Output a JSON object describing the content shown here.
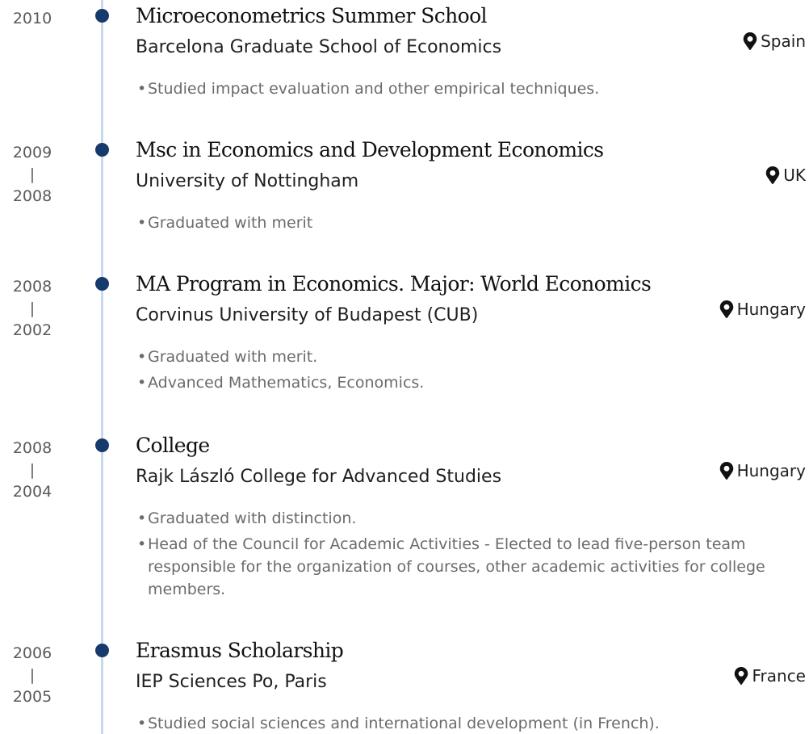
{
  "entries": [
    {
      "years": [
        "2010"
      ],
      "title": "Microeconometrics Summer School",
      "institution": "Barcelona Graduate School of Economics",
      "location": "Spain",
      "bullets": [
        "Studied impact evaluation and other empirical techniques."
      ]
    },
    {
      "years": [
        "2009",
        "2008"
      ],
      "title": "Msc in Economics and Development Economics",
      "institution": "University of Nottingham",
      "location": "UK",
      "bullets": [
        "Graduated with merit"
      ]
    },
    {
      "years": [
        "2008",
        "2002"
      ],
      "title": "MA Program in Economics. Major: World Economics",
      "institution": "Corvinus University of Budapest (CUB)",
      "location": "Hungary",
      "bullets": [
        "Graduated with merit.",
        "Advanced Mathematics, Economics."
      ]
    },
    {
      "years": [
        "2008",
        "2004"
      ],
      "title": "College",
      "institution": "Rajk László College for Advanced Studies",
      "location": "Hungary",
      "bullets": [
        "Graduated with distinction.",
        "Head of the Council for Academic Activities - Elected to lead five-person team responsible for the organization of courses, other academic activities for college members."
      ]
    },
    {
      "years": [
        "2006",
        "2005"
      ],
      "title": "Erasmus Scholarship",
      "institution": "IEP Sciences Po, Paris",
      "location": "France",
      "bullets": [
        "Studied social sciences and international development (in French)."
      ]
    }
  ],
  "year_separator": "|",
  "icons": {
    "location": "map-marker-icon",
    "timeline_dot": "timeline-dot-icon"
  },
  "colors": {
    "dot": "#163a6b",
    "line": "#c7d9ea",
    "bullet_text": "#6b6b6b"
  }
}
